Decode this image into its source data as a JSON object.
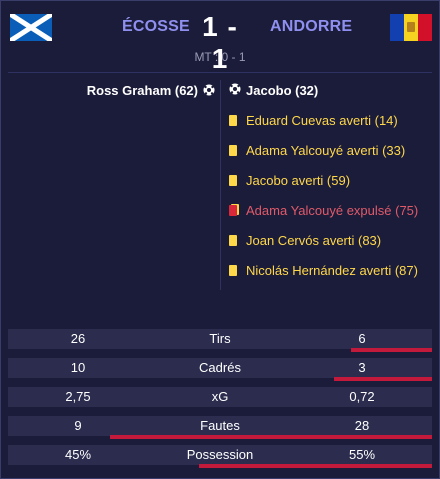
{
  "match": {
    "home_team": "ÉCOSSE",
    "away_team": "ANDORRE",
    "score": "1 - 1",
    "halftime": "MT : 0 - 1"
  },
  "flags": {
    "home": "scotland-flag",
    "away": "andorra-flag"
  },
  "colors": {
    "background": "#1b1c3a",
    "team_name": "#8f8ff0",
    "yellow_card": "#ffd84a",
    "red_card": "#e05a6a",
    "stat_bar": "#c31a3c"
  },
  "home_events": [
    {
      "type": "goal",
      "icon": "ball-icon",
      "text": "Ross Graham (62)"
    }
  ],
  "away_events": [
    {
      "type": "goal",
      "icon": "ball-icon",
      "text": "Jacobo (32)"
    },
    {
      "type": "yellow",
      "icon": "yellow-card-icon",
      "text": "Eduard Cuevas averti (14)"
    },
    {
      "type": "yellow",
      "icon": "yellow-card-icon",
      "text": "Adama Yalcouyé averti (33)"
    },
    {
      "type": "yellow",
      "icon": "yellow-card-icon",
      "text": "Jacobo averti (59)"
    },
    {
      "type": "red",
      "icon": "red-card-icon",
      "text": "Adama Yalcouyé expulsé (75)"
    },
    {
      "type": "yellow",
      "icon": "yellow-card-icon",
      "text": "Joan Cervós averti (83)"
    },
    {
      "type": "yellow",
      "icon": "yellow-card-icon",
      "text": "Nicolás Hernández averti (87)"
    }
  ],
  "stats": [
    {
      "label": "Tirs",
      "home": "26",
      "away": "6",
      "away_share": 0.19
    },
    {
      "label": "Cadrés",
      "home": "10",
      "away": "3",
      "away_share": 0.23
    },
    {
      "label": "xG",
      "home": "2,75",
      "away": "0,72",
      "away_share": 0
    },
    {
      "label": "Fautes",
      "home": "9",
      "away": "28",
      "away_share": 0.76
    },
    {
      "label": "Possession",
      "home": "45%",
      "away": "55%",
      "away_share": 0.55
    }
  ]
}
